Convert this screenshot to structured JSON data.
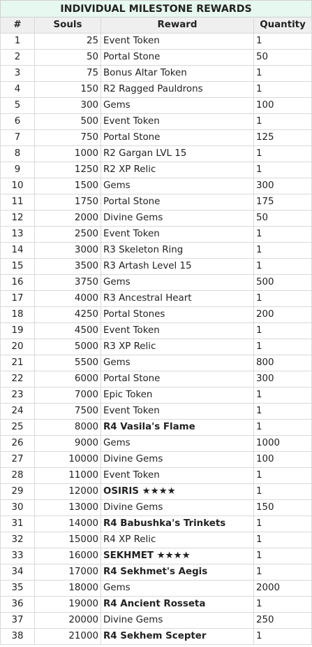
{
  "title": "INDIVIDUAL MILESTONE REWARDS",
  "columns": [
    "#",
    "Souls",
    "Reward",
    "Quantity"
  ],
  "rows": [
    {
      "n": "1",
      "souls": "25",
      "reward": "Event Token",
      "qty": "1",
      "bold": false
    },
    {
      "n": "2",
      "souls": "50",
      "reward": "Portal Stone",
      "qty": "50",
      "bold": false
    },
    {
      "n": "3",
      "souls": "75",
      "reward": "Bonus Altar Token",
      "qty": "1",
      "bold": false
    },
    {
      "n": "4",
      "souls": "150",
      "reward": "R2 Ragged Pauldrons",
      "qty": "1",
      "bold": false
    },
    {
      "n": "5",
      "souls": "300",
      "reward": "Gems",
      "qty": "100",
      "bold": false
    },
    {
      "n": "6",
      "souls": "500",
      "reward": "Event Token",
      "qty": "1",
      "bold": false
    },
    {
      "n": "7",
      "souls": "750",
      "reward": "Portal Stone",
      "qty": "125",
      "bold": false
    },
    {
      "n": "8",
      "souls": "1000",
      "reward": "R2 Gargan LVL 15",
      "qty": "1",
      "bold": false
    },
    {
      "n": "9",
      "souls": "1250",
      "reward": "R2 XP Relic",
      "qty": "1",
      "bold": false
    },
    {
      "n": "10",
      "souls": "1500",
      "reward": "Gems",
      "qty": "300",
      "bold": false
    },
    {
      "n": "11",
      "souls": "1750",
      "reward": "Portal Stone",
      "qty": "175",
      "bold": false
    },
    {
      "n": "12",
      "souls": "2000",
      "reward": "Divine Gems",
      "qty": "50",
      "bold": false
    },
    {
      "n": "13",
      "souls": "2500",
      "reward": "Event Token",
      "qty": "1",
      "bold": false
    },
    {
      "n": "14",
      "souls": "3000",
      "reward": "R3 Skeleton Ring",
      "qty": "1",
      "bold": false
    },
    {
      "n": "15",
      "souls": "3500",
      "reward": "R3 Artash Level 15",
      "qty": "1",
      "bold": false
    },
    {
      "n": "16",
      "souls": "3750",
      "reward": "Gems",
      "qty": "500",
      "bold": false
    },
    {
      "n": "17",
      "souls": "4000",
      "reward": "R3 Ancestral Heart",
      "qty": "1",
      "bold": false
    },
    {
      "n": "18",
      "souls": "4250",
      "reward": "Portal Stones",
      "qty": "200",
      "bold": false
    },
    {
      "n": "19",
      "souls": "4500",
      "reward": "Event Token",
      "qty": "1",
      "bold": false
    },
    {
      "n": "20",
      "souls": "5000",
      "reward": "R3 XP Relic",
      "qty": "1",
      "bold": false
    },
    {
      "n": "21",
      "souls": "5500",
      "reward": "Gems",
      "qty": "800",
      "bold": false
    },
    {
      "n": "22",
      "souls": "6000",
      "reward": "Portal Stone",
      "qty": "300",
      "bold": false
    },
    {
      "n": "23",
      "souls": "7000",
      "reward": "Epic Token",
      "qty": "1",
      "bold": false
    },
    {
      "n": "24",
      "souls": "7500",
      "reward": "Event Token",
      "qty": "1",
      "bold": false
    },
    {
      "n": "25",
      "souls": "8000",
      "reward": "R4 Vasila's Flame",
      "qty": "1",
      "bold": true
    },
    {
      "n": "26",
      "souls": "9000",
      "reward": "Gems",
      "qty": "1000",
      "bold": false
    },
    {
      "n": "27",
      "souls": "10000",
      "reward": "Divine Gems",
      "qty": "100",
      "bold": false
    },
    {
      "n": "28",
      "souls": "11000",
      "reward": "Event Token",
      "qty": "1",
      "bold": false
    },
    {
      "n": "29",
      "souls": "12000",
      "reward": "OSIRIS ★★★★",
      "qty": "1",
      "bold": true
    },
    {
      "n": "30",
      "souls": "13000",
      "reward": "Divine Gems",
      "qty": "150",
      "bold": false
    },
    {
      "n": "31",
      "souls": "14000",
      "reward": "R4 Babushka's Trinkets",
      "qty": "1",
      "bold": true
    },
    {
      "n": "32",
      "souls": "15000",
      "reward": "R4 XP Relic",
      "qty": "1",
      "bold": false
    },
    {
      "n": "33",
      "souls": "16000",
      "reward": "SEKHMET ★★★★",
      "qty": "1",
      "bold": true
    },
    {
      "n": "34",
      "souls": "17000",
      "reward": "R4 Sekhmet's Aegis",
      "qty": "1",
      "bold": true
    },
    {
      "n": "35",
      "souls": "18000",
      "reward": "Gems",
      "qty": "2000",
      "bold": false
    },
    {
      "n": "36",
      "souls": "19000",
      "reward": "R4 Ancient Rosseta",
      "qty": "1",
      "bold": true
    },
    {
      "n": "37",
      "souls": "20000",
      "reward": "Divine Gems",
      "qty": "250",
      "bold": false
    },
    {
      "n": "38",
      "souls": "21000",
      "reward": "R4 Sekhem Scepter",
      "qty": "1",
      "bold": true
    }
  ]
}
